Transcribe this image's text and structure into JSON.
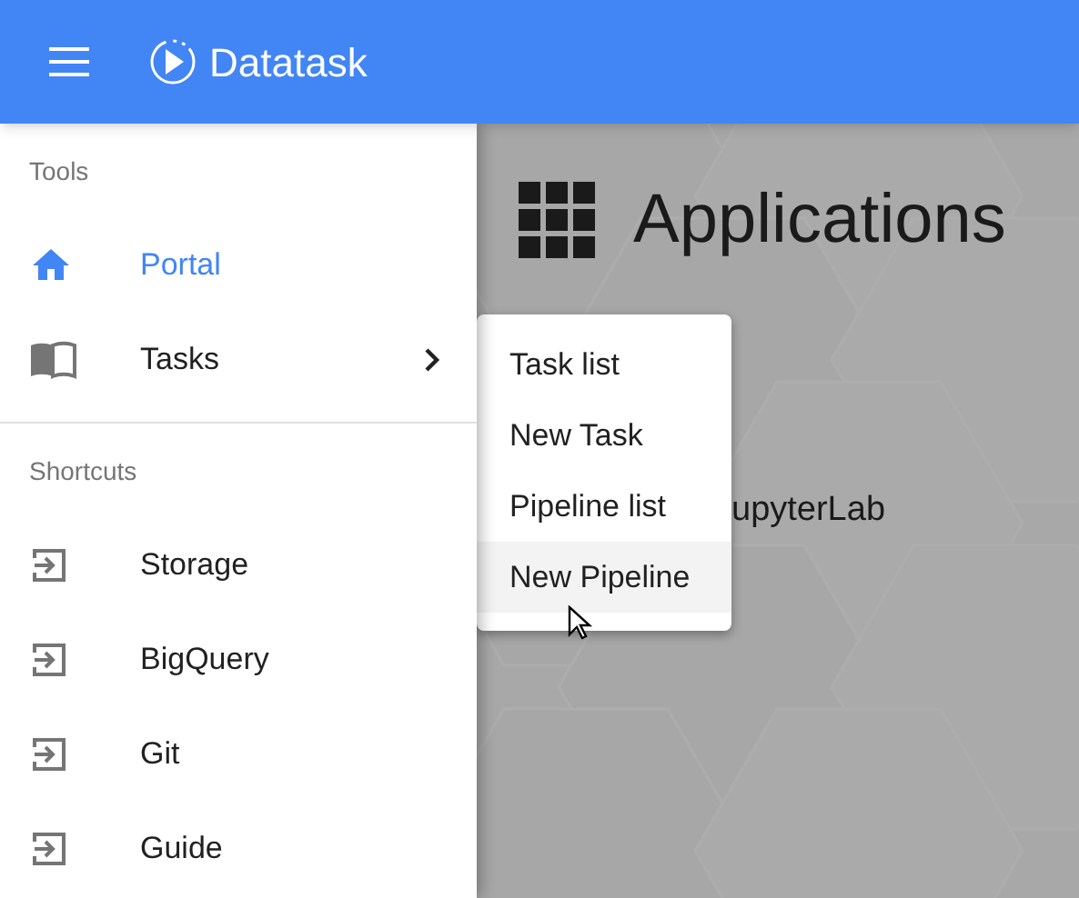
{
  "app_bar": {
    "title": "Datatask"
  },
  "sidebar": {
    "sections": [
      {
        "heading": "Tools",
        "items": [
          {
            "label": "Portal",
            "kind": "home",
            "selected": true,
            "submenu": false
          },
          {
            "label": "Tasks",
            "kind": "book",
            "selected": false,
            "submenu": true
          }
        ]
      },
      {
        "heading": "Shortcuts",
        "items": [
          {
            "label": "Storage",
            "kind": "link",
            "selected": false,
            "submenu": false
          },
          {
            "label": "BigQuery",
            "kind": "link",
            "selected": false,
            "submenu": false
          },
          {
            "label": "Git",
            "kind": "link",
            "selected": false,
            "submenu": false
          },
          {
            "label": "Guide",
            "kind": "link",
            "selected": false,
            "submenu": false
          }
        ]
      }
    ]
  },
  "main": {
    "heading": "Applications",
    "card_label": "upyterLab"
  },
  "submenu": {
    "items": [
      {
        "label": "Task list",
        "selected": false
      },
      {
        "label": "New Task",
        "selected": false
      },
      {
        "label": "Pipeline list",
        "selected": false
      },
      {
        "label": "New Pipeline",
        "selected": true
      }
    ]
  }
}
